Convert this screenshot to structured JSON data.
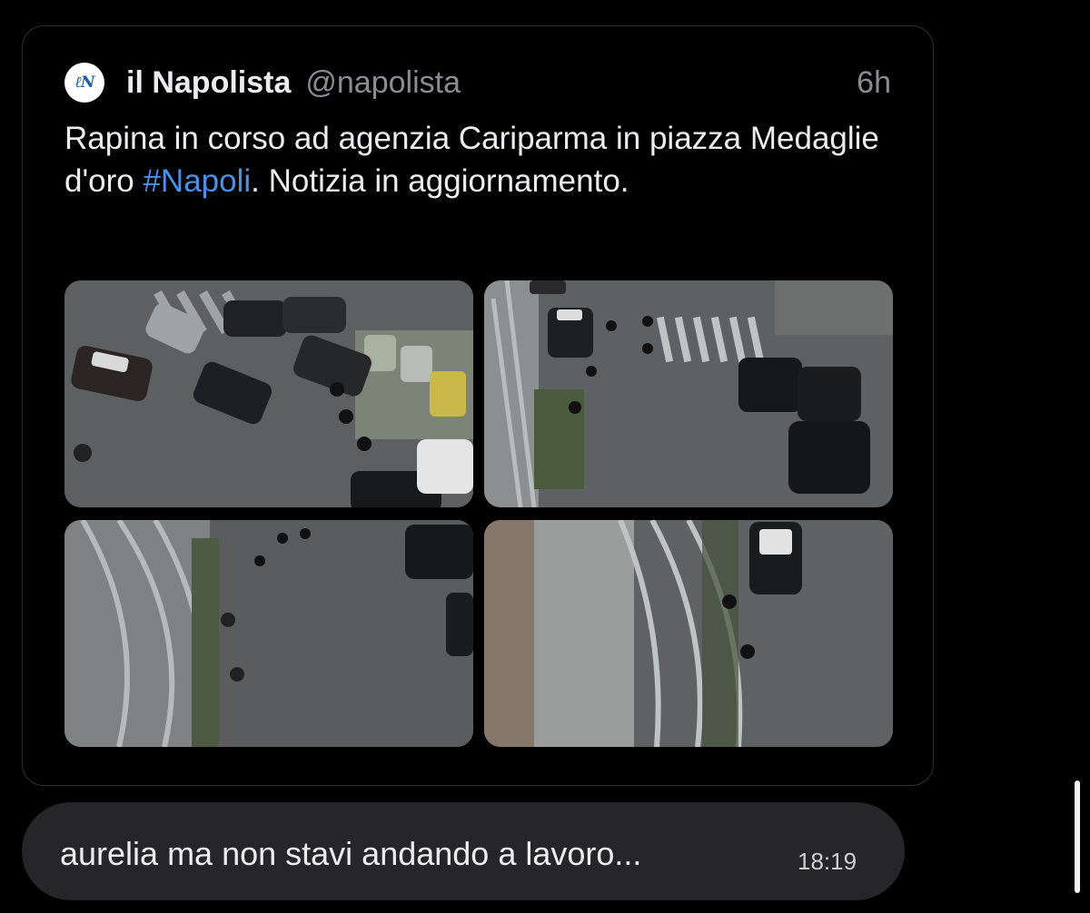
{
  "tweet": {
    "author_name": "il Napolista",
    "author_handle": "@napolista",
    "time": "6h",
    "avatar_text": "ℓN",
    "text_before": "Rapina in corso ad agenzia Cariparma in piazza Medaglie d'oro ",
    "hashtag": "#Napoli",
    "text_after": ". Notizia in aggiornamento."
  },
  "message": {
    "text": "aurelia ma non stavi andando a lavoro...",
    "time": "18:19"
  },
  "colors": {
    "background": "#000000",
    "hashtag": "#4a90e8",
    "bubble": "#262628",
    "muted_text": "#8b8b91"
  }
}
